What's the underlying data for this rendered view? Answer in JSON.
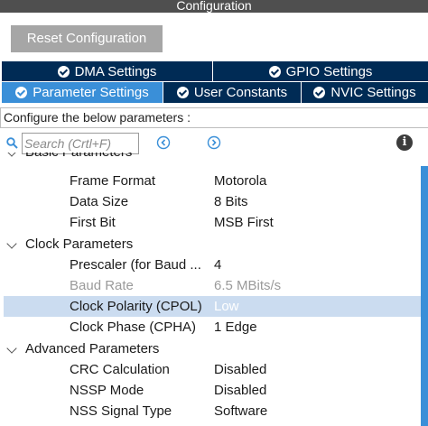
{
  "window": {
    "title": "Configuration"
  },
  "toolbar": {
    "reset_label": "Reset Configuration"
  },
  "tabs_row1": [
    {
      "label": "DMA Settings",
      "active": false
    },
    {
      "label": "GPIO Settings",
      "active": false
    }
  ],
  "tabs_row2": [
    {
      "label": "Parameter Settings",
      "active": true
    },
    {
      "label": "User Constants",
      "active": false
    },
    {
      "label": "NVIC Settings",
      "active": false
    }
  ],
  "configure_text": "Configure the below parameters :",
  "search": {
    "placeholder": "Search (Crtl+F)"
  },
  "info_symbol": "i",
  "groups": [
    {
      "name": "Basic Parameters",
      "params": [
        {
          "name": "Frame Format",
          "value": "Motorola"
        },
        {
          "name": "Data Size",
          "value": "8 Bits"
        },
        {
          "name": "First Bit",
          "value": "MSB First"
        }
      ]
    },
    {
      "name": "Clock Parameters",
      "params": [
        {
          "name": "Prescaler (for Baud ...",
          "value": "4"
        },
        {
          "name": "Baud Rate",
          "value": "6.5 MBits/s",
          "disabled": true
        },
        {
          "name": "Clock Polarity (CPOL)",
          "value": "Low",
          "selected": true
        },
        {
          "name": "Clock Phase (CPHA)",
          "value": "1 Edge"
        }
      ]
    },
    {
      "name": "Advanced Parameters",
      "params": [
        {
          "name": "CRC Calculation",
          "value": "Disabled"
        },
        {
          "name": "NSSP Mode",
          "value": "Disabled"
        },
        {
          "name": "NSS Signal Type",
          "value": "Software"
        }
      ]
    }
  ],
  "colors": {
    "tab_inactive": "#002b55",
    "tab_active": "#3a8fd8",
    "selection": "#cbdcf0",
    "scrollbar": "#3a8fd8"
  }
}
